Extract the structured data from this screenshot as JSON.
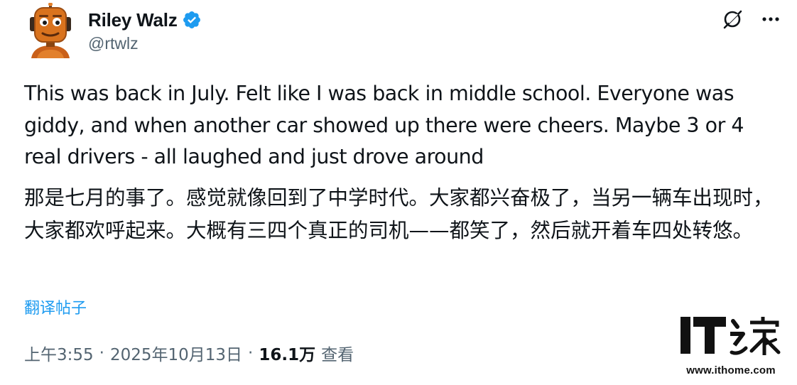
{
  "author": {
    "display_name": "Riley Walz",
    "handle": "@rtwlz",
    "verified": true,
    "verified_color": "#1d9bf0"
  },
  "actions": {
    "grok_icon": "grok-icon",
    "more_icon": "more-icon"
  },
  "tweet": {
    "text_en": "This was back in July. Felt like I was back in middle school. Everyone was giddy, and when another car showed up there were cheers. Maybe 3 or 4 real drivers - all laughed and just drove around",
    "text_zh": "那是七月的事了。感觉就像回到了中学时代。大家都兴奋极了，当另一辆车出现时，大家都欢呼起来。大概有三四个真正的司机——都笑了，然后就开着车四处转悠。",
    "translate_label": "翻译帖子"
  },
  "meta": {
    "time": "上午3:55",
    "separator": "·",
    "date": "2025年10月13日",
    "views_count": "16.1万",
    "views_label": "查看"
  },
  "watermark": {
    "logo_text": "IT之家",
    "url": "www.ithome.com"
  },
  "colors": {
    "accent": "#1d9bf0",
    "text": "#0f1419",
    "secondary": "#536471",
    "avatar_orange": "#d9731e"
  }
}
